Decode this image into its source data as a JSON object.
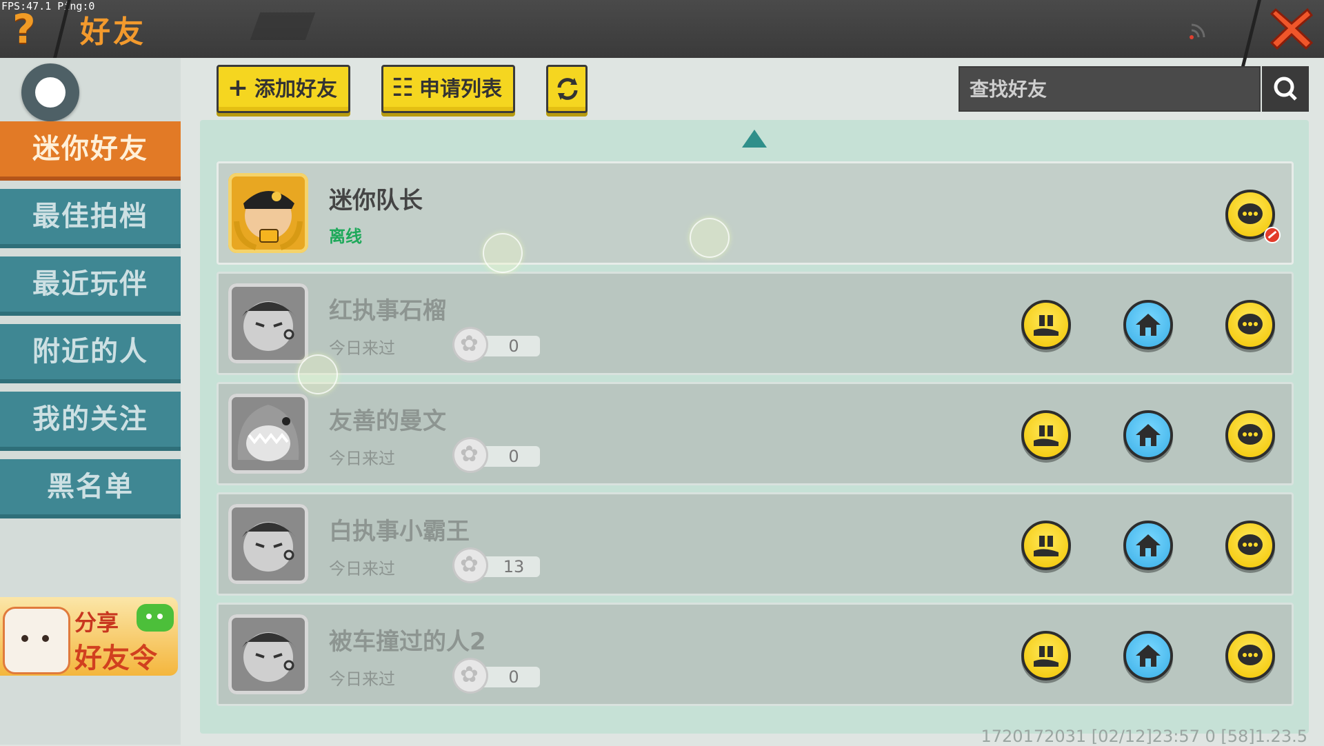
{
  "hud": {
    "fps_text": "FPS:47.1  Ping:0"
  },
  "header": {
    "title": "好友",
    "help_icon": "question-mark-icon",
    "close_icon": "close-x-icon",
    "signal_icon": "signal-icon"
  },
  "sidebar": {
    "items": [
      {
        "label": "迷你好友",
        "active": true
      },
      {
        "label": "最佳拍档",
        "active": false
      },
      {
        "label": "最近玩伴",
        "active": false
      },
      {
        "label": "附近的人",
        "active": false
      },
      {
        "label": "我的关注",
        "active": false
      },
      {
        "label": "黑名单",
        "active": false
      }
    ],
    "share": {
      "line1": "分享",
      "line2": "好友令"
    }
  },
  "toolbar": {
    "add_friend": "添加好友",
    "request_list": "申请列表",
    "search_placeholder": "查找好友"
  },
  "friends": [
    {
      "name": "迷你队长",
      "status": "离线"
    },
    {
      "name": "红执事石榴",
      "visited": "今日来过",
      "flowers": "0"
    },
    {
      "name": "友善的曼文",
      "visited": "今日来过",
      "flowers": "0"
    },
    {
      "name": "白执事小霸王",
      "visited": "今日来过",
      "flowers": "13"
    },
    {
      "name": "被车撞过的人2",
      "visited": "今日来过",
      "flowers": "0"
    }
  ],
  "footer": {
    "info": "1720172031    [02/12]23:57 0  [58]1.23.5"
  },
  "colors": {
    "accent_orange": "#e27a26",
    "tab_teal": "#3f8793",
    "button_yellow": "#f5d620",
    "online_green": "#1ea95a"
  }
}
